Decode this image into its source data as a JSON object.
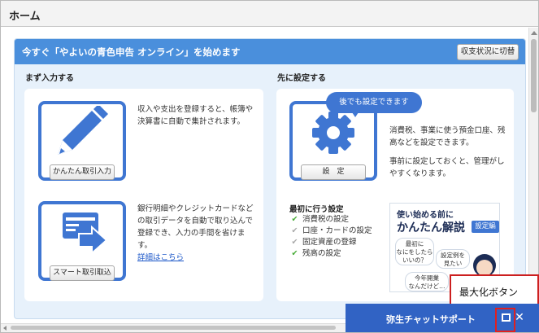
{
  "window": {
    "title": "ホーム"
  },
  "banner": {
    "title": "今すぐ「やよいの青色申告 オンライン」を始めます",
    "switch_button": "収支状況に切替"
  },
  "left_section": {
    "heading": "まず入力する",
    "cards": [
      {
        "icon": "pencil-icon",
        "button": "かんたん取引入力",
        "lines": [
          "収入や支出を登録すると、帳簿や",
          "決算書に自動で集計されます。"
        ]
      },
      {
        "icon": "import-icon",
        "button": "スマート取引取込",
        "lines": [
          "銀行明細やクレジットカードなど",
          "の取引データを自動で取り込んで",
          "登録でき、入力の手間を省けま",
          "す。"
        ],
        "link": "詳細はこちら"
      }
    ]
  },
  "right_section": {
    "heading": "先に設定する",
    "bubble": "後でも設定できます",
    "settings_button": "設　定",
    "settings_icon": "gear-icon",
    "lines1": [
      "消費税、事業に使う預金口座、残",
      "高などを設定できます。"
    ],
    "lines2": [
      "事前に設定しておくと、管理がし",
      "やすくなります。"
    ],
    "first_title": "最初に行う設定",
    "checklist": [
      {
        "label": "消費税の設定",
        "done": true
      },
      {
        "label": "口座・カードの設定",
        "done": false
      },
      {
        "label": "固定資産の登録",
        "done": false
      },
      {
        "label": "残高の設定",
        "done": true
      }
    ],
    "promo": {
      "line1": "使い始める前に",
      "line2": "かんたん解説",
      "tag": "設定編",
      "bubble1": [
        "最初に",
        "なにをしたら",
        "いいの？"
      ],
      "bubble2": [
        "設定例を",
        "見たい"
      ],
      "bubble3": [
        "今年開業",
        "なんだけど…"
      ]
    }
  },
  "chat": {
    "label": "弥生チャットサポート",
    "close": "✕"
  },
  "callout": {
    "label": "最大化ボタン"
  },
  "colors": {
    "accent": "#3f76d2",
    "banner": "#4a8fdc",
    "chat_bar": "#3163c4",
    "highlight": "#e02020",
    "check_done": "#44aa33",
    "check_todo": "#a8a8a8"
  }
}
